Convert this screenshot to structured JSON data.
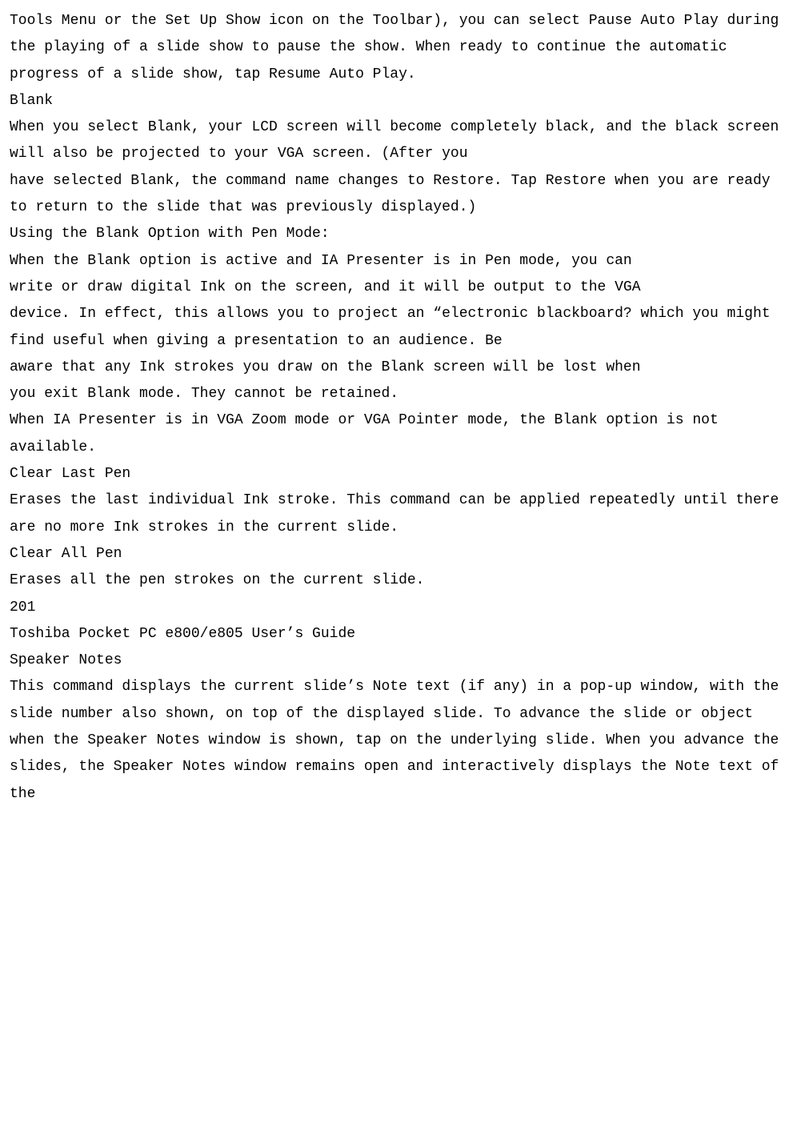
{
  "doc": {
    "p1": "Tools Menu or the Set Up Show icon on the Toolbar), you can select Pause Auto Play during the playing of a slide show to pause the show. When ready to continue the automatic progress of a slide show, tap Resume Auto Play.",
    "h_blank": "Blank",
    "p2": "When you select Blank, your LCD screen will become completely black, and the black screen will also be projected to your VGA screen. (After you",
    "p3": "have selected Blank, the command name changes to Restore. Tap Restore when you are ready to return to the slide that was previously displayed.)",
    "h_penmode": "Using the Blank Option with Pen Mode:",
    "p4": "When the Blank option is active and IA Presenter is in Pen mode, you can",
    "p5": "write or draw digital Ink on the screen, and it will be output to the VGA",
    "p6": "device. In effect, this allows you to project an “electronic blackboard? which you might find useful when giving a presentation to an audience. Be",
    "p7": "aware that any Ink strokes you draw on the Blank screen will be lost when",
    "p8": "you exit Blank mode. They cannot be retained.",
    "p9": "When IA Presenter is in VGA Zoom mode or VGA Pointer mode, the Blank option is not available.",
    "h_clearlast": "Clear Last Pen",
    "p10": "Erases the last individual Ink stroke. This command can be applied repeatedly until there are no more Ink strokes in the current slide.",
    "h_clearall": "Clear All Pen",
    "p11": "Erases all the pen strokes on the current slide.",
    "pagenum": "201",
    "guide": "Toshiba Pocket PC e800/e805 User’s Guide",
    "h_speaker": "Speaker Notes",
    "p12": "This command displays the current slide’s Note text (if any) in a pop-up window, with the slide number also shown, on top of the displayed slide. To advance the slide or object when the Speaker Notes window is shown, tap on the underlying slide. When you advance the slides, the Speaker Notes window remains open and interactively displays the Note text of the"
  }
}
